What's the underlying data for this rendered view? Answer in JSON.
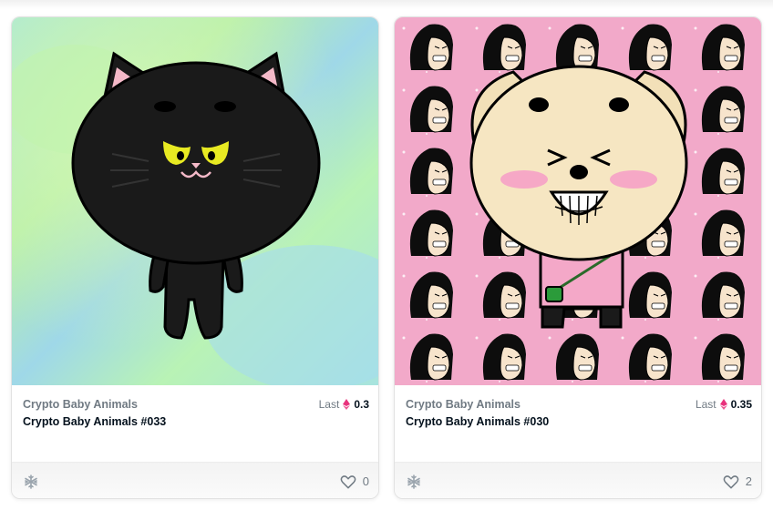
{
  "cards": [
    {
      "collection": "Crypto Baby Animals",
      "name": "Crypto Baby Animals #033",
      "price_label": "Last",
      "price": "0.3",
      "likes": "0",
      "art": "black-cat",
      "currency_icon": "eth-diamond-icon",
      "network_icon": "snowflake-icon",
      "like_icon": "heart-icon"
    },
    {
      "collection": "Crypto Baby Animals",
      "name": "Crypto Baby Animals #030",
      "price_label": "Last",
      "price": "0.35",
      "likes": "2",
      "art": "beige-dog",
      "currency_icon": "eth-diamond-icon",
      "network_icon": "snowflake-icon",
      "like_icon": "heart-icon"
    }
  ],
  "colors": {
    "accent_pink": "#e8327c",
    "text_primary": "#04111d",
    "text_secondary": "#707a83"
  }
}
